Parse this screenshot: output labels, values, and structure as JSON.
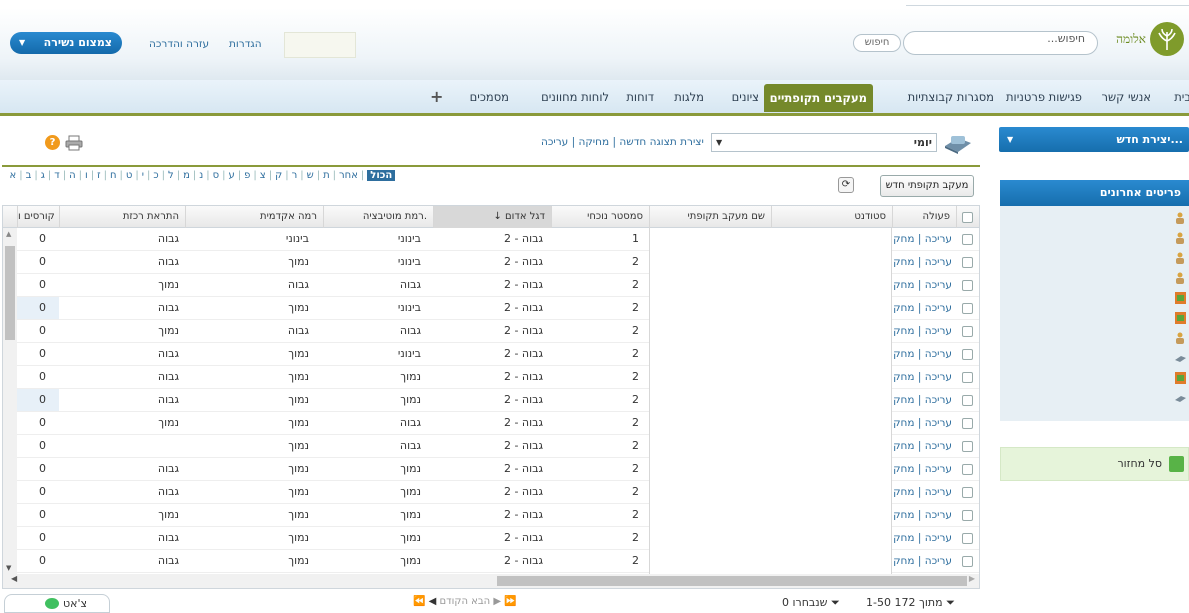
{
  "header": {
    "logo_text": "אלומה",
    "search_placeholder": "חיפוש...",
    "search_button": "חיפוש",
    "settings_link": "הגדרות",
    "help_link": "עזרה והדרכה",
    "scope_button": "צמצום נשירה"
  },
  "nav": {
    "items": [
      "בית",
      "אנשי קשר",
      "פגישות פרטניות",
      "מסגרות קבוצתיות",
      "מעקבים תקופתיים",
      "ציונים",
      "מלגות",
      "דוחות",
      "לוחות מחוונים",
      "מסמכים"
    ],
    "active": "מעקבים תקופתיים",
    "plus": "+"
  },
  "toolbar": {
    "view_select": "יומי",
    "edit_link": "עריכה",
    "delete_link": "מחיקה",
    "create_view_link": "יצירת תצוגה חדשה",
    "separator": "|"
  },
  "letters": {
    "all": "הכול",
    "other": "אחר",
    "list": [
      "א",
      "ב",
      "ג",
      "ד",
      "ה",
      "ו",
      "ז",
      "ח",
      "ט",
      "י",
      "כ",
      "ל",
      "מ",
      "נ",
      "ס",
      "ע",
      "פ",
      "צ",
      "ק",
      "ר",
      "ש",
      "ת"
    ]
  },
  "buttons": {
    "new_tracking": "מעקב תקופתי חדש",
    "refresh": "⟳"
  },
  "table": {
    "headers": {
      "action": "פעולה",
      "student": "סטודנט",
      "tracking_name": "שם מעקב תקופתי",
      "semester": "סמסטר נוכחי",
      "red_flag": "דגל אדום",
      "motivation": "רמת מוטיבציה.",
      "academic": "רמה אקדמית",
      "persistence": "התראת רכזת",
      "courses": "קורסים ו"
    },
    "sort_arrow": "↓",
    "action_edit": "עריכה",
    "action_delete": "מחק",
    "action_sep": " | ",
    "rows": [
      {
        "semester": "1",
        "flag": "2 - גבוה",
        "motivation": "בינוני",
        "academic": "בינוני",
        "persistence": "גבוה",
        "courses": "0"
      },
      {
        "semester": "2",
        "flag": "2 - גבוה",
        "motivation": "בינוני",
        "academic": "נמוך",
        "persistence": "גבוה",
        "courses": "0"
      },
      {
        "semester": "2",
        "flag": "2 - גבוה",
        "motivation": "גבוה",
        "academic": "גבוה",
        "persistence": "נמוך",
        "courses": "0"
      },
      {
        "semester": "2",
        "flag": "2 - גבוה",
        "motivation": "בינוני",
        "academic": "נמוך",
        "persistence": "גבוה",
        "courses": "0"
      },
      {
        "semester": "2",
        "flag": "2 - גבוה",
        "motivation": "גבוה",
        "academic": "גבוה",
        "persistence": "נמוך",
        "courses": "0"
      },
      {
        "semester": "2",
        "flag": "2 - גבוה",
        "motivation": "בינוני",
        "academic": "נמוך",
        "persistence": "גבוה",
        "courses": "0"
      },
      {
        "semester": "2",
        "flag": "2 - גבוה",
        "motivation": "נמוך",
        "academic": "נמוך",
        "persistence": "גבוה",
        "courses": "0"
      },
      {
        "semester": "2",
        "flag": "2 - גבוה",
        "motivation": "נמוך",
        "academic": "נמוך",
        "persistence": "גבוה",
        "courses": "0"
      },
      {
        "semester": "2",
        "flag": "2 - גבוה",
        "motivation": "גבוה",
        "academic": "נמוך",
        "persistence": "נמוך",
        "courses": "0"
      },
      {
        "semester": "2",
        "flag": "2 - גבוה",
        "motivation": "גבוה",
        "academic": "נמוך",
        "persistence": "",
        "courses": "0"
      },
      {
        "semester": "2",
        "flag": "2 - גבוה",
        "motivation": "נמוך",
        "academic": "נמוך",
        "persistence": "גבוה",
        "courses": "0"
      },
      {
        "semester": "2",
        "flag": "2 - גבוה",
        "motivation": "נמוך",
        "academic": "נמוך",
        "persistence": "גבוה",
        "courses": "0"
      },
      {
        "semester": "2",
        "flag": "2 - גבוה",
        "motivation": "נמוך",
        "academic": "נמוך",
        "persistence": "נמוך",
        "courses": "0"
      },
      {
        "semester": "2",
        "flag": "2 - גבוה",
        "motivation": "נמוך",
        "academic": "נמוך",
        "persistence": "גבוה",
        "courses": "0"
      },
      {
        "semester": "2",
        "flag": "2 - גבוה",
        "motivation": "נמוך",
        "academic": "נמוך",
        "persistence": "גבוה",
        "courses": "0"
      }
    ]
  },
  "pager": {
    "range": "1-50 מתוך 172",
    "selected": "0 שנבחרו",
    "prev": "הקודם",
    "next": "הבא"
  },
  "sidebar": {
    "new_create": "יצירת חדש...",
    "recent_title": "פריטים אחרונים",
    "recycle": "סל מחזור"
  },
  "chat": {
    "label": "צ'אט"
  },
  "colors": {
    "accent_blue": "#1f7dc2",
    "nav_active": "#75892b",
    "link": "#2e6e9e"
  }
}
